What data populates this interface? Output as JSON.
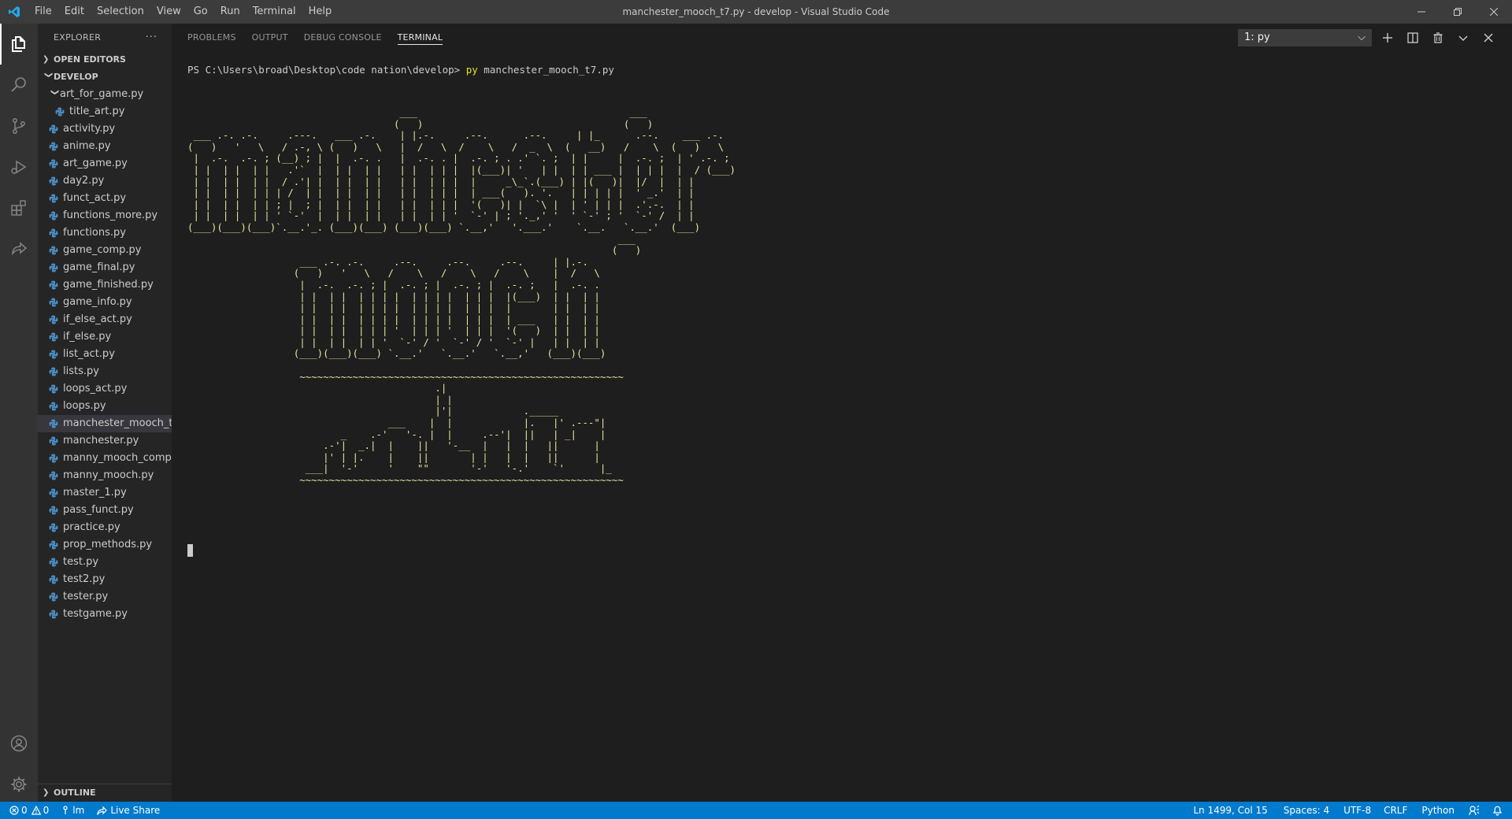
{
  "titlebar": {
    "menu": [
      "File",
      "Edit",
      "Selection",
      "View",
      "Go",
      "Run",
      "Terminal",
      "Help"
    ],
    "window_title": "manchester_mooch_t7.py - develop - Visual Studio Code"
  },
  "explorer": {
    "header": "EXPLORER",
    "more": "···",
    "open_editors": "OPEN EDITORS",
    "root": "DEVELOP",
    "folder": "art_for_game.py",
    "folder_children": [
      "title_art.py"
    ],
    "files": [
      "activity.py",
      "anime.py",
      "art_game.py",
      "day2.py",
      "funct_act.py",
      "functions_more.py",
      "functions.py",
      "game_comp.py",
      "game_final.py",
      "game_finished.py",
      "game_info.py",
      "if_else_act.py",
      "if_else.py",
      "list_act.py",
      "lists.py",
      "loops_act.py",
      "loops.py",
      "manchester_mooch_t...",
      "manchester.py",
      "manny_mooch_comp....",
      "manny_mooch.py",
      "master_1.py",
      "pass_funct.py",
      "practice.py",
      "prop_methods.py",
      "test.py",
      "test2.py",
      "tester.py",
      "testgame.py"
    ],
    "selected_file": "manchester_mooch_t...",
    "outline": "OUTLINE"
  },
  "panel": {
    "tabs": [
      "PROBLEMS",
      "OUTPUT",
      "DEBUG CONSOLE",
      "TERMINAL"
    ],
    "active_tab": "TERMINAL",
    "terminal_select": "1: py"
  },
  "terminal": {
    "prompt": "PS C:\\Users\\broad\\Desktop\\code nation\\develop> ",
    "command": "py",
    "args": " manchester_mooch_t7.py",
    "art": "                                    ___                                    ___\n                                   (   )                                  (   )\n ___ .-. .-.     .---.   ___ .-.    | |.-.     .--.      .--.     | |_      .--.    ___ .-.\n(   )   '   \\   / .-, \\ (   )   \\   |  /   \\  /    \\   /  _  \\  (   __)   /    \\  (   )   \\\n |  .-.  .-. ; (__) ; |  |  .-. .   |  .-. . |  .-. ; . .' `. ;  | |     |  .-. ;  | ' .-. ;\n | |  | |  | |   .'`  |  | |  | |   | |  | | |  |(___)| '   | |  | | ___ |  | | |  |  / (___)\n | |  | |  | |  / .'| |  | |  | |   | |  | | |  |     _\\_`.(___) | |(   )|  |/  |  | |\n | |  | |  | | | /  | |  | |  | |   | |  | | |  | ___(   ). '.   | | | | |  ' _.'  | |\n | |  | |  | | ; |  ; |  | |  | |   | |  | | |  '(   )| |  `\\ |  | ' | | |  .'.-.  | |\n | |  | |  | | ' `-'  |  | |  | |   | |  | | '  `-' | ; '._,' '  ' `-' ; '  `-' /  | |\n(___)(___)(___)`.__.'_. (___)(___) (___)(___) `.__,'   '.___.'    `.__.   `.__.'  (___)\n                                                                         ___\n                                                                        (   )\n                   ___ .-. .-.     .--.     .--.     .--.     | |.-.\n                  (   )   '   \\   /    \\   /    \\   /    \\    |  /   \\\n                   |  .-.  .-. ; |  .-. ; |  .-. ; |  .-. ;   |  .-. .\n                   | |  | |  | | | |  | | | |  | | |  |(___)  | |  | |\n                   | |  | |  | | | |  | | | |  | | |  |       | |  | |\n                   | |  | |  | | | |  | | | |  | | |  | ___   | |  | |\n                   | |  | |  | | | '  | | | '  | | |  '(   )  | |  | |\n                   | |  | |  | | '  `-' / '  `-' / '  `-' |   | |  | |\n                  (___)(___)(___) `.__.'   `.__.'   `.__,'   (___)(___)\n\n                   ~~~~~~~~~~~~~~~~~~~~~~~~~~~~~~~~~~~~~~~~~~~~~~~~~~~~~~~\n                                          .|\n                                          | |\n                                          |'|            ._____\n                                  ___    |  |            |.   |' .---\"|\n                          _    .-'   '-. |  |     .--'|  ||   | _|    |\n                       .-'|  _.|  |    ||   '-__  |   |  |   ||      |\n                       |' | |.    |    ||       | |   |  |   ||      |\n                    ___|  '-'     '    \"\"       '-'   '-.'    `'      |_\n                   ~~~~~~~~~~~~~~~~~~~~~~~~~~~~~~~~~~~~~~~~~~~~~~~~~~~~~~~"
  },
  "statusbar": {
    "errors": "0",
    "warnings": "0",
    "branch": "lm",
    "liveshare": "Live Share",
    "position": "Ln 1499, Col 15",
    "spaces": "Spaces: 4",
    "encoding": "UTF-8",
    "eol": "CRLF",
    "language": "Python"
  }
}
